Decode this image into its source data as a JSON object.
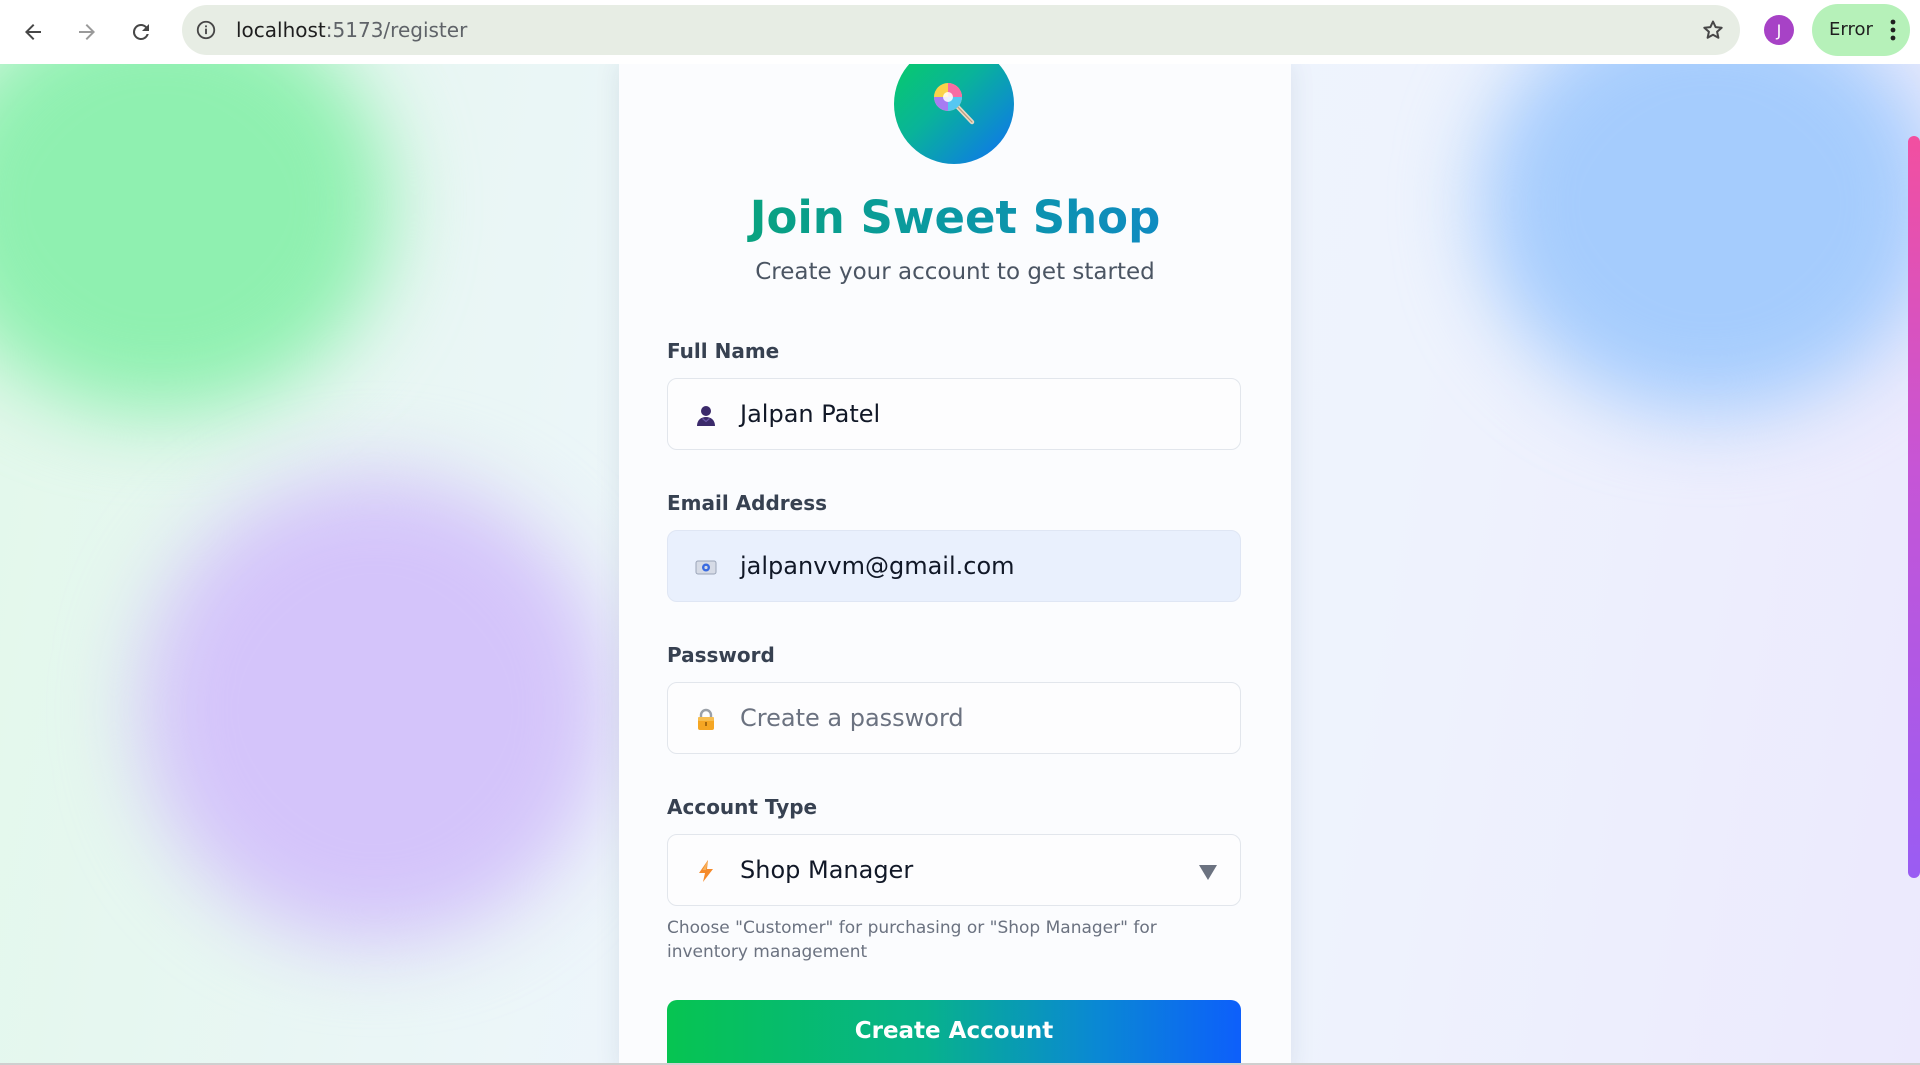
{
  "browser": {
    "url_host": "localhost",
    "url_path": ":5173/register",
    "profile_initial": "J",
    "profile_color": "#a742c6",
    "error_label": "Error",
    "icons": [
      "back-arrow-icon",
      "forward-arrow-icon",
      "reload-icon",
      "site-info-icon",
      "bookmark-star-icon",
      "more-vert-icon"
    ]
  },
  "page": {
    "title": "Join Sweet Shop",
    "subtitle": "Create your account to get started",
    "logo_icon": "lollipop-icon"
  },
  "form": {
    "full_name": {
      "label": "Full Name",
      "value": "Jalpan Patel",
      "icon": "user-icon"
    },
    "email": {
      "label": "Email Address",
      "value": "jalpanvvm@gmail.com",
      "icon": "email-card-icon"
    },
    "password": {
      "label": "Password",
      "value": "",
      "placeholder": "Create a password",
      "icon": "lock-icon"
    },
    "account_type": {
      "label": "Account Type",
      "selected": "Shop Manager",
      "icon": "lightning-icon"
    },
    "hint": "Choose \"Customer\" for purchasing or \"Shop Manager\" for inventory management",
    "submit_label": "Create Account"
  },
  "colors": {
    "accent_green": "#06c451",
    "accent_blue": "#0d5ffb",
    "title_teal": "#0c97a7"
  }
}
